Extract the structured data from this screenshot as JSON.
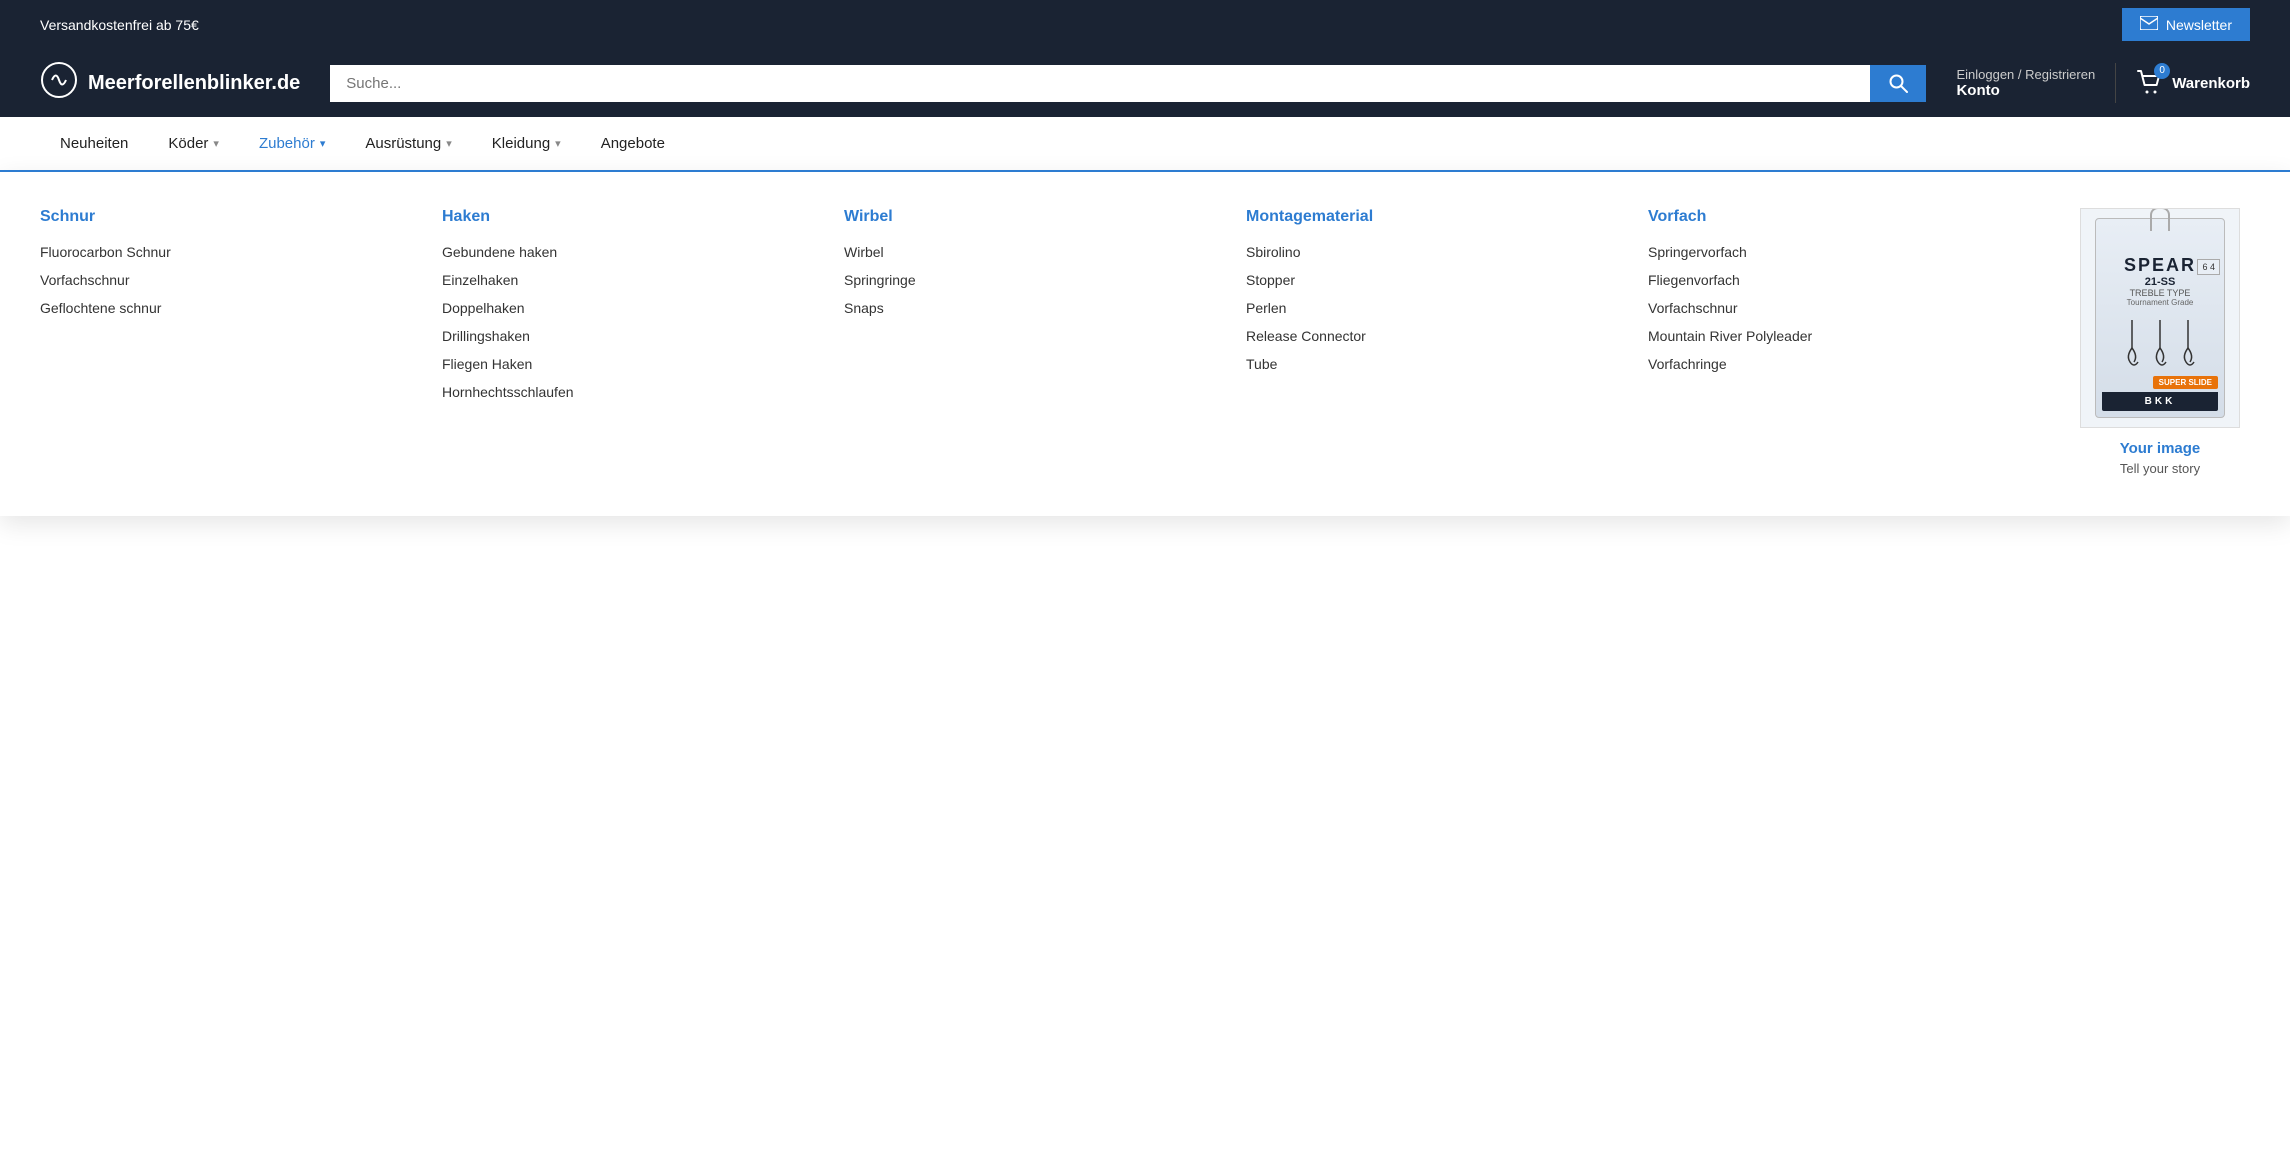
{
  "topBanner": {
    "shippingText": "Versandkostenfrei ab 75€",
    "newsletterLabel": "Newsletter"
  },
  "header": {
    "logoText": "Meerforellenblinker.de",
    "searchPlaceholder": "Suche...",
    "accountTopLabel": "Einloggen / Registrieren",
    "accountBottomLabel": "Konto",
    "cartBadge": "0",
    "cartLabel": "Warenkorb"
  },
  "nav": {
    "items": [
      {
        "label": "Neuheiten",
        "hasDropdown": false,
        "active": false
      },
      {
        "label": "Köder",
        "hasDropdown": true,
        "active": false
      },
      {
        "label": "Zubehör",
        "hasDropdown": true,
        "active": true
      },
      {
        "label": "Ausrüstung",
        "hasDropdown": true,
        "active": false
      },
      {
        "label": "Kleidung",
        "hasDropdown": true,
        "active": false
      },
      {
        "label": "Angebote",
        "hasDropdown": false,
        "active": false
      }
    ]
  },
  "dropdown": {
    "columns": [
      {
        "heading": "Schnur",
        "links": [
          "Fluorocarbon Schnur",
          "Vorfachschnur",
          "Geflochtene schnur"
        ]
      },
      {
        "heading": "Haken",
        "links": [
          "Gebundene haken",
          "Einzelhaken",
          "Doppelhaken",
          "Drillingshaken",
          "Fliegen Haken",
          "Hornhechtsschlaufen"
        ]
      },
      {
        "heading": "Wirbel",
        "links": [
          "Wirbel",
          "Springringe",
          "Snaps"
        ]
      },
      {
        "heading": "Montagematerial",
        "links": [
          "Sbirolino",
          "Stopper",
          "Perlen",
          "Release Connector",
          "Tube"
        ]
      },
      {
        "heading": "Vorfach",
        "links": [
          "Springervorfach",
          "Fliegenvorfach",
          "Vorfachschnur",
          "Mountain River Polyleader",
          "Vorfachringe"
        ]
      }
    ],
    "productImage": {
      "title": "SPEAR",
      "subtitle": "21-SS",
      "trebleLabel": "TREBLE TYPE",
      "gradeLabel": "Tournament Grade",
      "sizeLabel": "6 4",
      "badge": "SUPER SLIDE",
      "brand": "BKK",
      "imageCaption": "Your image",
      "imageSubcaption": "Tell your story"
    }
  }
}
